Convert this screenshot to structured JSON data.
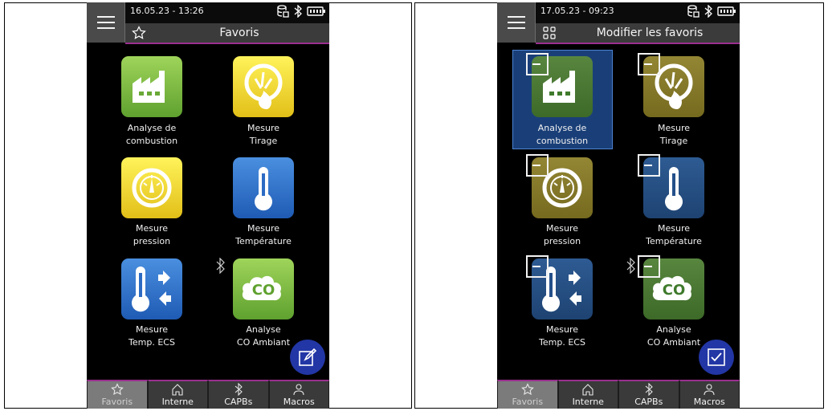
{
  "left": {
    "datetime": "16.05.23 - 13:26",
    "title": "Favoris",
    "tiles": [
      {
        "line1": "Analyse de",
        "line2": "combustion"
      },
      {
        "line1": "Mesure",
        "line2": "Tirage"
      },
      {
        "line1": "Mesure",
        "line2": "pression"
      },
      {
        "line1": "Mesure",
        "line2": "Température"
      },
      {
        "line1": "Mesure",
        "line2": "Temp. ECS"
      },
      {
        "line1": "Analyse",
        "line2": "CO Ambiant"
      }
    ],
    "nav": [
      "Favoris",
      "Interne",
      "CAPBs",
      "Macros"
    ]
  },
  "right": {
    "datetime": "17.05.23 - 09:23",
    "title": "Modifier les favoris",
    "tiles": [
      {
        "line1": "Analyse de",
        "line2": "combustion"
      },
      {
        "line1": "Mesure",
        "line2": "Tirage"
      },
      {
        "line1": "Mesure",
        "line2": "pression"
      },
      {
        "line1": "Mesure",
        "line2": "Température"
      },
      {
        "line1": "Mesure",
        "line2": "Temp. ECS"
      },
      {
        "line1": "Analyse",
        "line2": "CO Ambiant"
      }
    ],
    "nav": [
      "Favoris",
      "Interne",
      "CAPBs",
      "Macros"
    ]
  },
  "icons": {
    "status": [
      "database-icon",
      "bluetooth-icon",
      "battery-icon"
    ],
    "nav": [
      "star-icon",
      "home-icon",
      "bluetooth-icon",
      "user-icon"
    ]
  },
  "colors": {
    "accent_line": "#9a2f8f",
    "fab": "#2236a5",
    "selection": "#4a83d2"
  }
}
